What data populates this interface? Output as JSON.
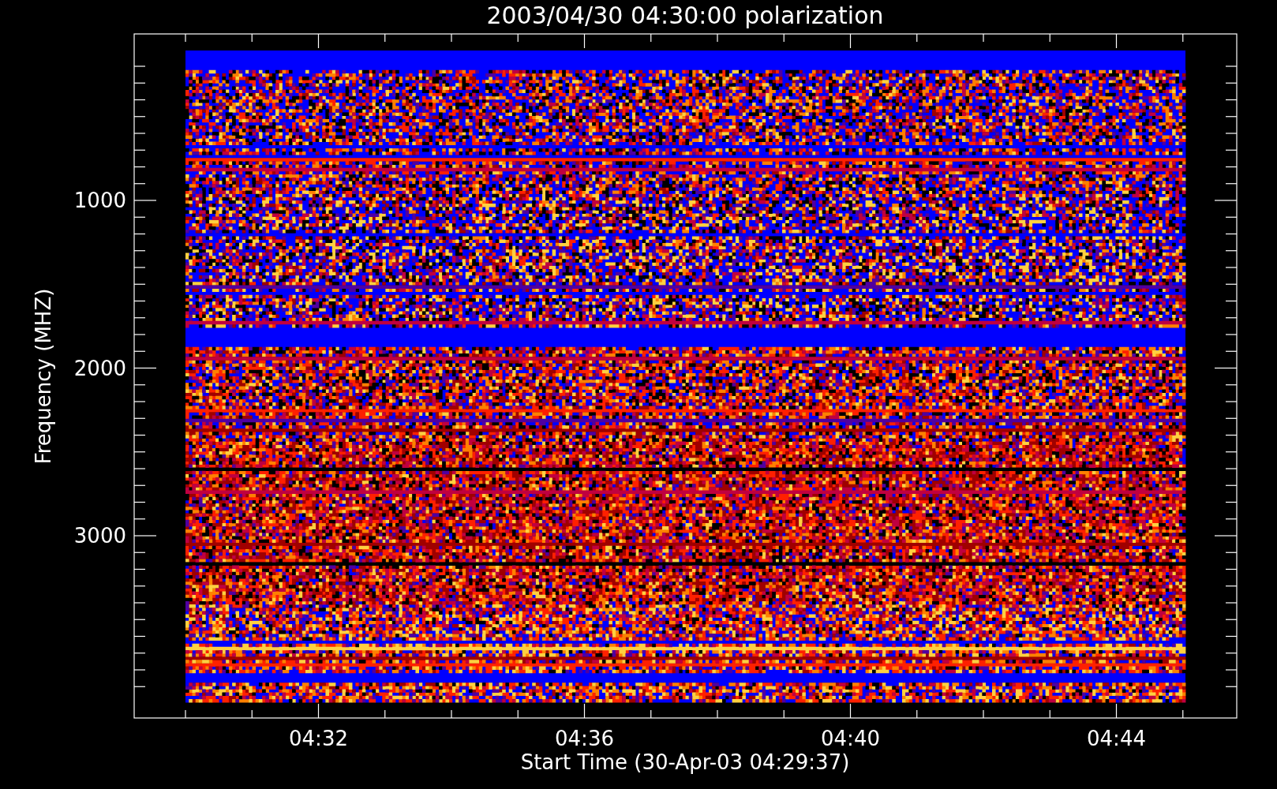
{
  "title": "2003/04/30 04:30:00 polarization",
  "y_axis": {
    "label": "Frequency (MHZ)",
    "ticks": [
      "1000",
      "2000",
      "3000"
    ]
  },
  "x_axis": {
    "label": "Start Time (30-Apr-03 04:29:37)",
    "ticks": [
      "04:32",
      "04:36",
      "04:40",
      "04:44"
    ]
  }
}
